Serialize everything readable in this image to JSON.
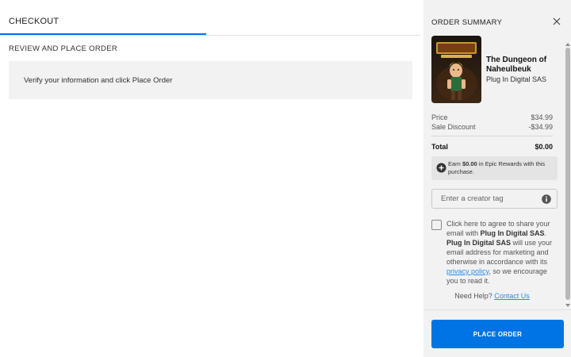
{
  "checkout": {
    "tab_label": "CHECKOUT",
    "section_title": "REVIEW AND PLACE ORDER",
    "info_message": "Verify your information and click Place Order"
  },
  "summary": {
    "title": "ORDER SUMMARY",
    "game": {
      "title": "The Dungeon of Naheulbeuk",
      "publisher": "Plug In Digital SAS",
      "cover_logo_text": "THE DUNGEON OF NAHEULBEUK"
    },
    "price_label": "Price",
    "price_value": "$34.99",
    "discount_label": "Sale Discount",
    "discount_value": "-$34.99",
    "total_label": "Total",
    "total_value": "$0.00",
    "rewards": {
      "prefix": "Earn ",
      "amount": "$0.00",
      "suffix": " in Epic Rewards with this purchase."
    },
    "creator_tag_placeholder": "Enter a creator tag",
    "consent": {
      "part1": "Click here to agree to share your email with ",
      "publisher_bold_1": "Plug In Digital SAS",
      "part2": ". ",
      "publisher_bold_2": "Plug In Digital SAS",
      "part3": " will use your email address for marketing and otherwise in accordance with its ",
      "link": "privacy policy",
      "part4": ", so we encourage you to read it."
    },
    "help_text": "Need Help? ",
    "help_link": "Contact Us",
    "place_order_label": "PLACE ORDER"
  },
  "colors": {
    "accent": "#0074e4",
    "link": "#2a8be8",
    "summary_bg": "#f2f2f2"
  },
  "icons": [
    "close-icon",
    "plus-circle-icon",
    "info-icon"
  ]
}
